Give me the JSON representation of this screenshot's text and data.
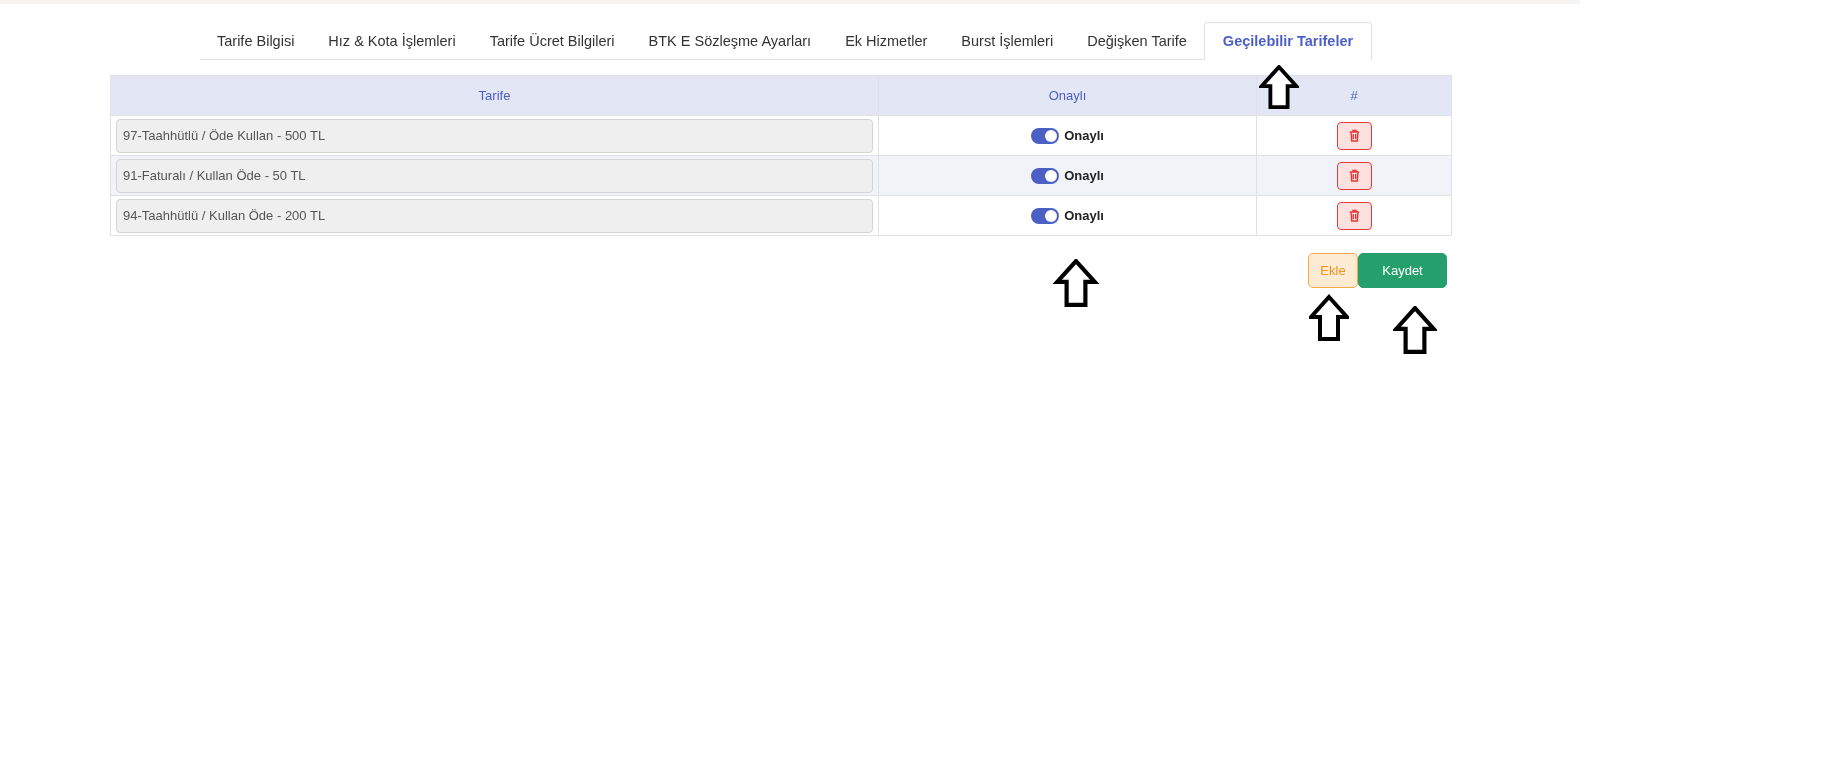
{
  "tabs": [
    {
      "label": "Tarife Bilgisi",
      "selected": false
    },
    {
      "label": "Hız & Kota İşlemleri",
      "selected": false
    },
    {
      "label": "Tarife Ücret Bilgileri",
      "selected": false
    },
    {
      "label": "BTK E Sözleşme Ayarları",
      "selected": false
    },
    {
      "label": "Ek Hizmetler",
      "selected": false
    },
    {
      "label": "Burst İşlemleri",
      "selected": false
    },
    {
      "label": "Değişken Tarife",
      "selected": false
    },
    {
      "label": "Geçilebilir Tarifeler",
      "selected": true
    }
  ],
  "table": {
    "columns": [
      "Tarife",
      "Onaylı",
      "#"
    ],
    "rows": [
      {
        "tariff": "97-Taahhütlü / Öde Kullan - 500 TL",
        "approved": true,
        "approved_label": "Onaylı"
      },
      {
        "tariff": "91-Faturalı / Kullan Öde - 50 TL",
        "approved": true,
        "approved_label": "Onaylı"
      },
      {
        "tariff": "94-Taahhütlü / Kullan Öde - 200 TL",
        "approved": true,
        "approved_label": "Onaylı"
      }
    ]
  },
  "buttons": [
    {
      "label": "Ekle",
      "kind": "add"
    },
    {
      "label": "Kaydet",
      "kind": "save"
    }
  ]
}
